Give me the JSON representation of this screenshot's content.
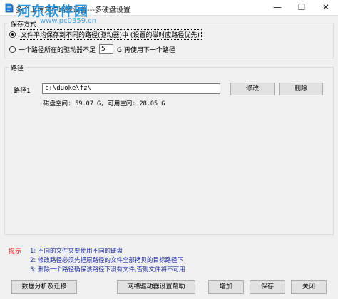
{
  "window": {
    "title": "多个上传文件路径设置---多硬盘设置",
    "watermark": "河东软件园",
    "watermark_url": "www.pc0359.cn",
    "min_icon": "—",
    "max_icon": "☐",
    "close_icon": "✕"
  },
  "mode_group": {
    "legend": "保存方式",
    "option1": {
      "label": "文件平均保存到不同的路径(驱动器)中 (设置的磁时应路径优先)",
      "checked": true
    },
    "option2": {
      "prefix": "一个路径所在的驱动器不足",
      "value": "5",
      "suffix": "G 再使用下一个路径",
      "checked": false
    }
  },
  "path_group": {
    "legend": "路径",
    "path_label": "路径1",
    "path_value": "c:\\duoke\\fz\\",
    "edit_button": "修改",
    "delete_button": "删除",
    "disk_info": "磁盘空间: 59.07 G, 可用空间: 28.05 G"
  },
  "tips": {
    "label": "提示",
    "items": [
      "1: 不同的文件夹要使用不同的硬盘",
      "2: 修改路径必须先把原路径的文件全部拷贝的目标路径下",
      "3: 删除一个路径确保该路径下没有文件,否则文件将不可用"
    ]
  },
  "footer": {
    "migrate_button": "数据分析及迁移",
    "help_button": "网络驱动器设置帮助",
    "add_button": "增加",
    "save_button": "保存",
    "close_button": "关闭"
  },
  "colors": {
    "tips_label": "#e02020",
    "tips_text": "#2030a0",
    "watermark": "#1e8fd6"
  }
}
